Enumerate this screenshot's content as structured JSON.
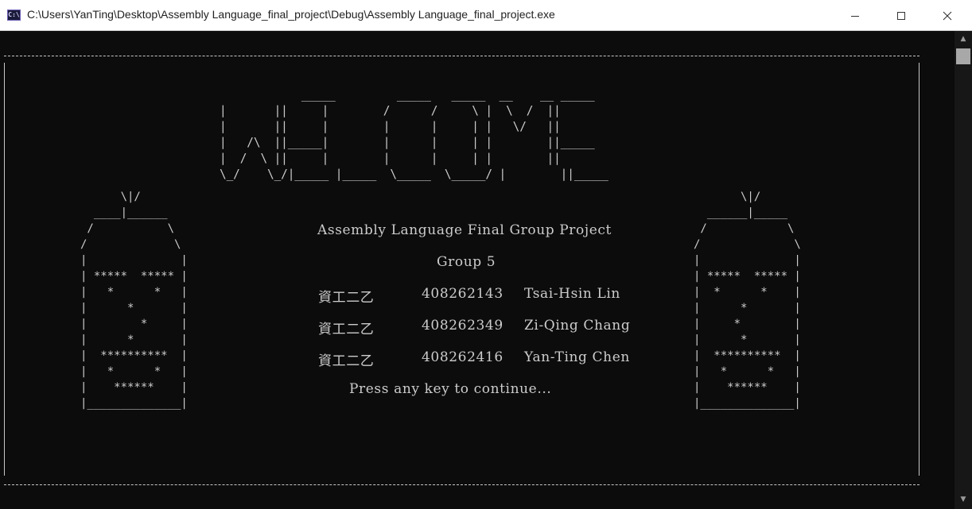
{
  "window": {
    "title": "C:\\Users\\YanTing\\Desktop\\Assembly Language_final_project\\Debug\\Assembly Language_final_project.exe",
    "icon_text": "C:\\",
    "buttons": [
      "minimize-icon",
      "maximize-icon",
      "close-icon"
    ]
  },
  "console": {
    "welcome_art": "            _____         _____   _____  __    __ _____\n|       ||     |        /      /     \\ |  \\  /  ||\n|       ||     |        |      |     | |   \\/   ||\n|   /\\  ||_____|        |      |     | |        ||_____\n|  /  \\ ||     |        |      |     | |        ||\n\\_/    \\_/|_____ |_____  \\_____  \\_____/ |        ||_____",
    "left_jar_art": "      \\|/\n  ____|______\n /           \\\n/             \\\n|              |\n| *****  ***** |\n|   *      *   |\n|      *       |\n|        *     |\n|      *       |\n|  **********  |\n|   *      *   |\n|    ******    |\n|______________|",
    "right_jar_art": "       \\|/\n  ______|_____\n /            \\\n/              \\\n|              |\n| *****  ***** |\n|  *      *    |\n|      *       |\n|     *        |\n|      *       |\n|  **********  |\n|   *      *   |\n|    ******    |\n|______________|",
    "project_title": "Assembly Language Final Group Project",
    "group": "Group 5",
    "members": [
      {
        "class": "資工二乙",
        "id": "408262143",
        "name": "Tsai-Hsin Lin"
      },
      {
        "class": "資工二乙",
        "id": "408262349",
        "name": "Zi-Qing Chang"
      },
      {
        "class": "資工二乙",
        "id": "408262416",
        "name": "Yan-Ting Chen"
      }
    ],
    "prompt": "Press any key to continue..."
  },
  "colors": {
    "console_bg": "#0c0c0c",
    "console_text": "#cccccc",
    "titlebar_bg": "#ffffff"
  }
}
